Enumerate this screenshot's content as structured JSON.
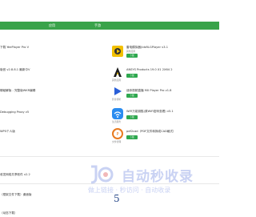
{
  "nav": {
    "tabs": [
      "应用",
      "手游"
    ]
  },
  "list": [
    {
      "left": "下载 YeePlayer Pro V",
      "name": "雷电模拟器(ldsRLGPlayer v3.1",
      "cat": "其他应用",
      "button": "下载",
      "color": "#f2c000",
      "icon": "ld-icon"
    },
    {
      "left": "版官 v2.8.8.1 最新中V",
      "name": "ANSYS Products 19.0 X1 2X64 2",
      "cat": "其他应用",
      "button": "下载",
      "color": "#1a1a1a",
      "icon": "ansys-icon"
    },
    {
      "left": "辑破解版 - 完整版WKR编辑",
      "name": "迷你视频直播 MX Player Pro v1.8",
      "cat": "影音视听",
      "button": "下载",
      "color": "#2a5fd8",
      "icon": "mx-play-icon"
    },
    {
      "left": "Debugging Proxy v5",
      "name": "WiFi万能钥匙(原WiFi密码查看) v5.1",
      "cat": "生活服务",
      "button": "下载",
      "color": "#2a8cf0",
      "icon": "wifi-icon"
    },
    {
      "left": "WPS个人版",
      "name": "pdf2cad（PDF文件转换成CAD格式）",
      "cat": "文件管理",
      "button": "下载",
      "color": "#e87a1e",
      "icon": "pdf-icon"
    }
  ],
  "lower": [
    {
      "left": "收发网络共享软件 v2.2"
    },
    {
      "left": "（框架文件下载）桌面版"
    },
    {
      "left": "（动态下载）"
    }
  ],
  "watermark": {
    "main": "自动秒收录",
    "sub": "做上链接 · 秒访问 · 自动收录"
  },
  "lower_icon": "5"
}
